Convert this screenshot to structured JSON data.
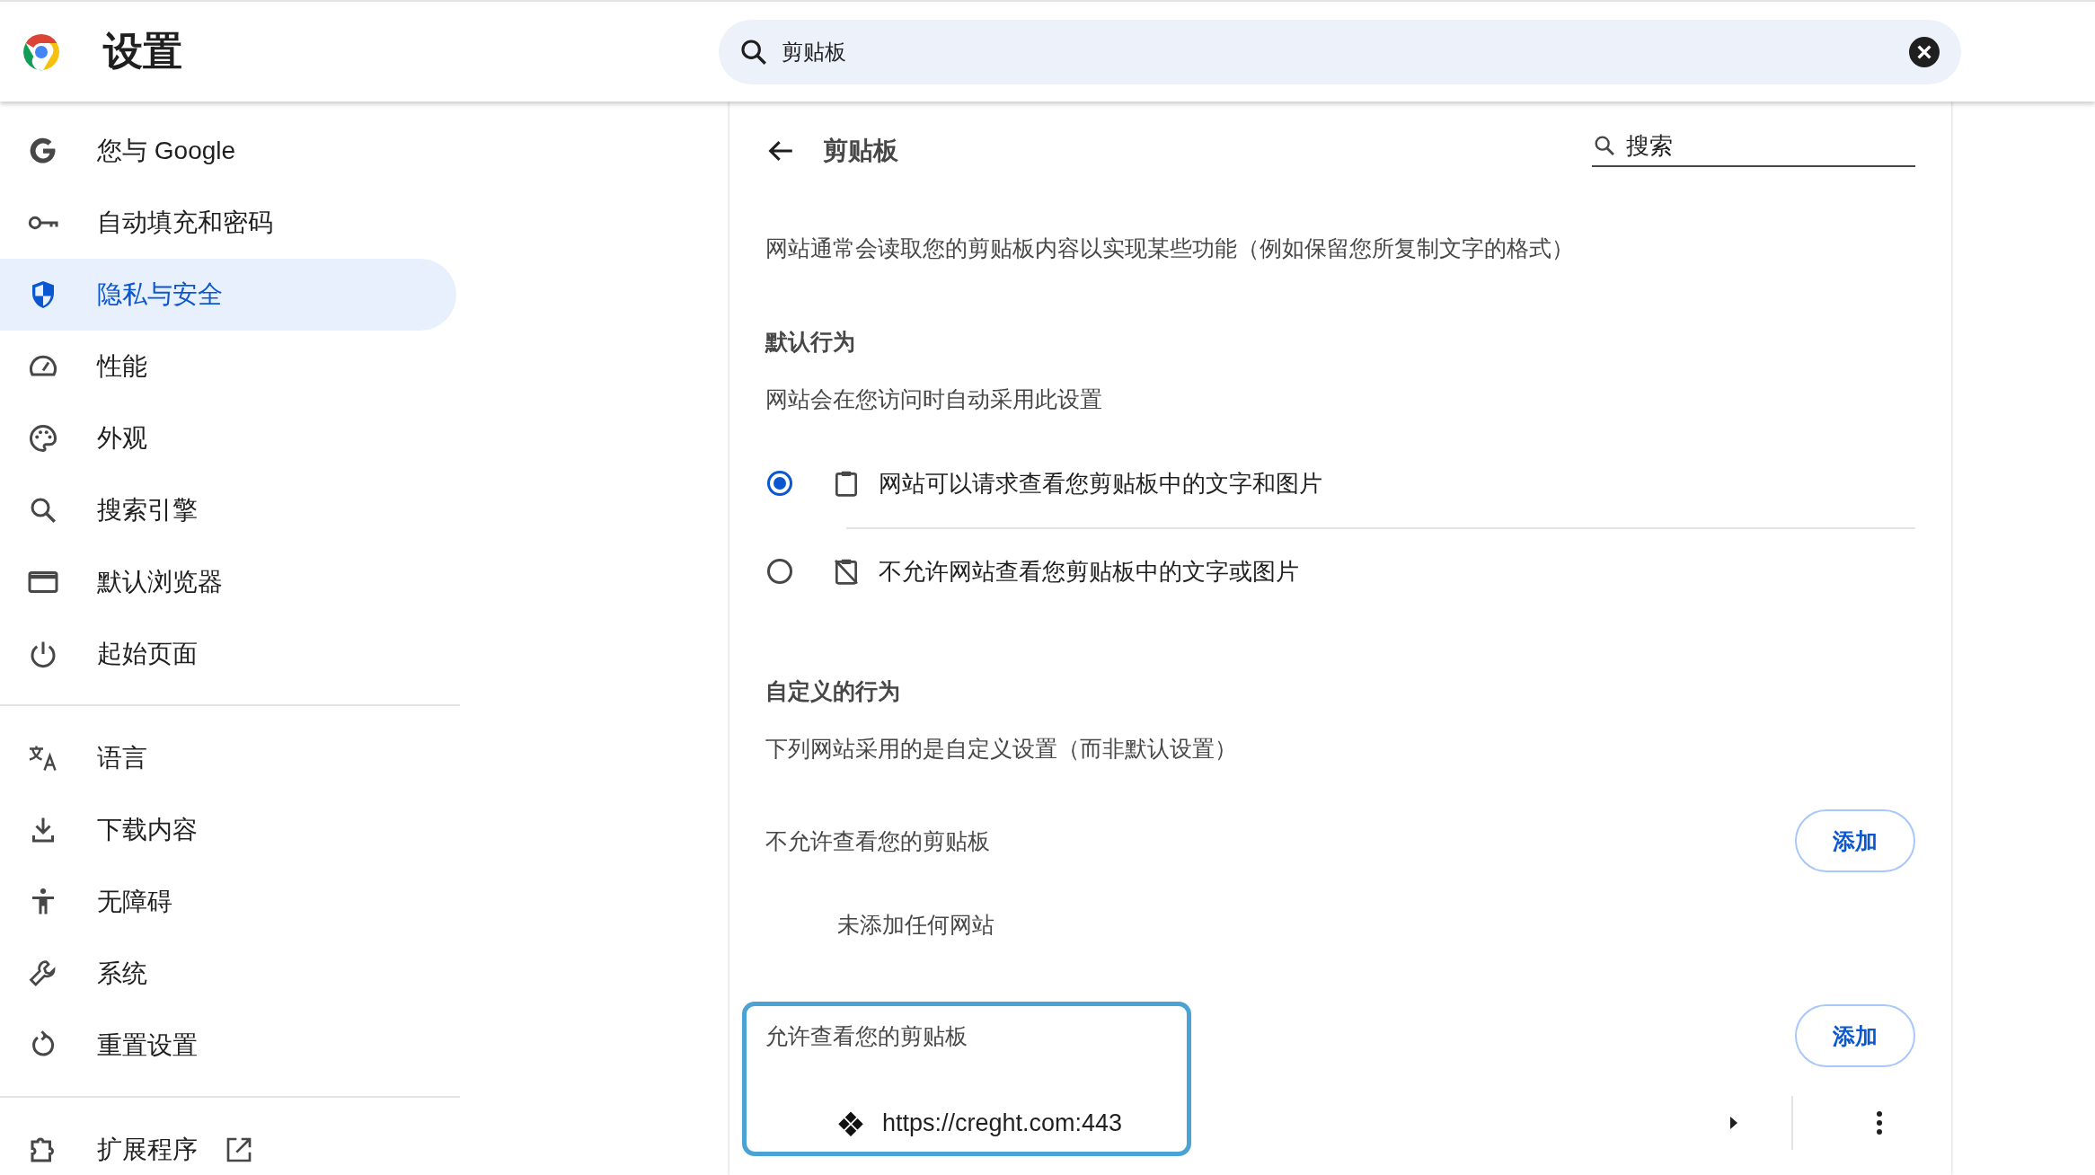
{
  "header": {
    "title": "设置",
    "search": {
      "value": "剪贴板"
    }
  },
  "sidebar": {
    "groups": [
      {
        "items": [
          {
            "label": "您与 Google",
            "selected": false,
            "kind": "link"
          },
          {
            "label": "自动填充和密码",
            "selected": false,
            "kind": "link"
          },
          {
            "label": "隐私与安全",
            "selected": true,
            "kind": "link"
          },
          {
            "label": "性能",
            "selected": false,
            "kind": "link"
          },
          {
            "label": "外观",
            "selected": false,
            "kind": "link"
          },
          {
            "label": "搜索引擎",
            "selected": false,
            "kind": "link"
          },
          {
            "label": "默认浏览器",
            "selected": false,
            "kind": "link"
          },
          {
            "label": "起始页面",
            "selected": false,
            "kind": "link"
          }
        ]
      },
      {
        "items": [
          {
            "label": "语言",
            "selected": false,
            "kind": "link"
          },
          {
            "label": "下载内容",
            "selected": false,
            "kind": "link"
          },
          {
            "label": "无障碍",
            "selected": false,
            "kind": "link"
          },
          {
            "label": "系统",
            "selected": false,
            "kind": "link"
          },
          {
            "label": "重置设置",
            "selected": false,
            "kind": "link"
          }
        ]
      },
      {
        "items": [
          {
            "label": "扩展程序",
            "selected": false,
            "kind": "external"
          }
        ]
      }
    ]
  },
  "page": {
    "title": "剪贴板",
    "search": {
      "placeholder": "搜索"
    },
    "description": "网站通常会读取您的剪贴板内容以实现某些功能（例如保留您所复制文字的格式）",
    "default_behavior": {
      "heading": "默认行为",
      "subtext": "网站会在您访问时自动采用此设置",
      "options": [
        {
          "label": "网站可以请求查看您剪贴板中的文字和图片",
          "selected": true,
          "kind": "allow"
        },
        {
          "label": "不允许网站查看您剪贴板中的文字或图片",
          "selected": false,
          "kind": "block"
        }
      ]
    },
    "custom_behavior": {
      "heading": "自定义的行为",
      "subtext": "下列网站采用的是自定义设置（而非默认设置）",
      "sections": [
        {
          "title": "不允许查看您的剪贴板",
          "button": "添加",
          "focused": false,
          "empty_text": "未添加任何网站"
        },
        {
          "title": "允许查看您的剪贴板",
          "button": "添加",
          "focused": true,
          "sites": [
            {
              "url": "https://creght.com:443"
            }
          ]
        }
      ]
    }
  }
}
